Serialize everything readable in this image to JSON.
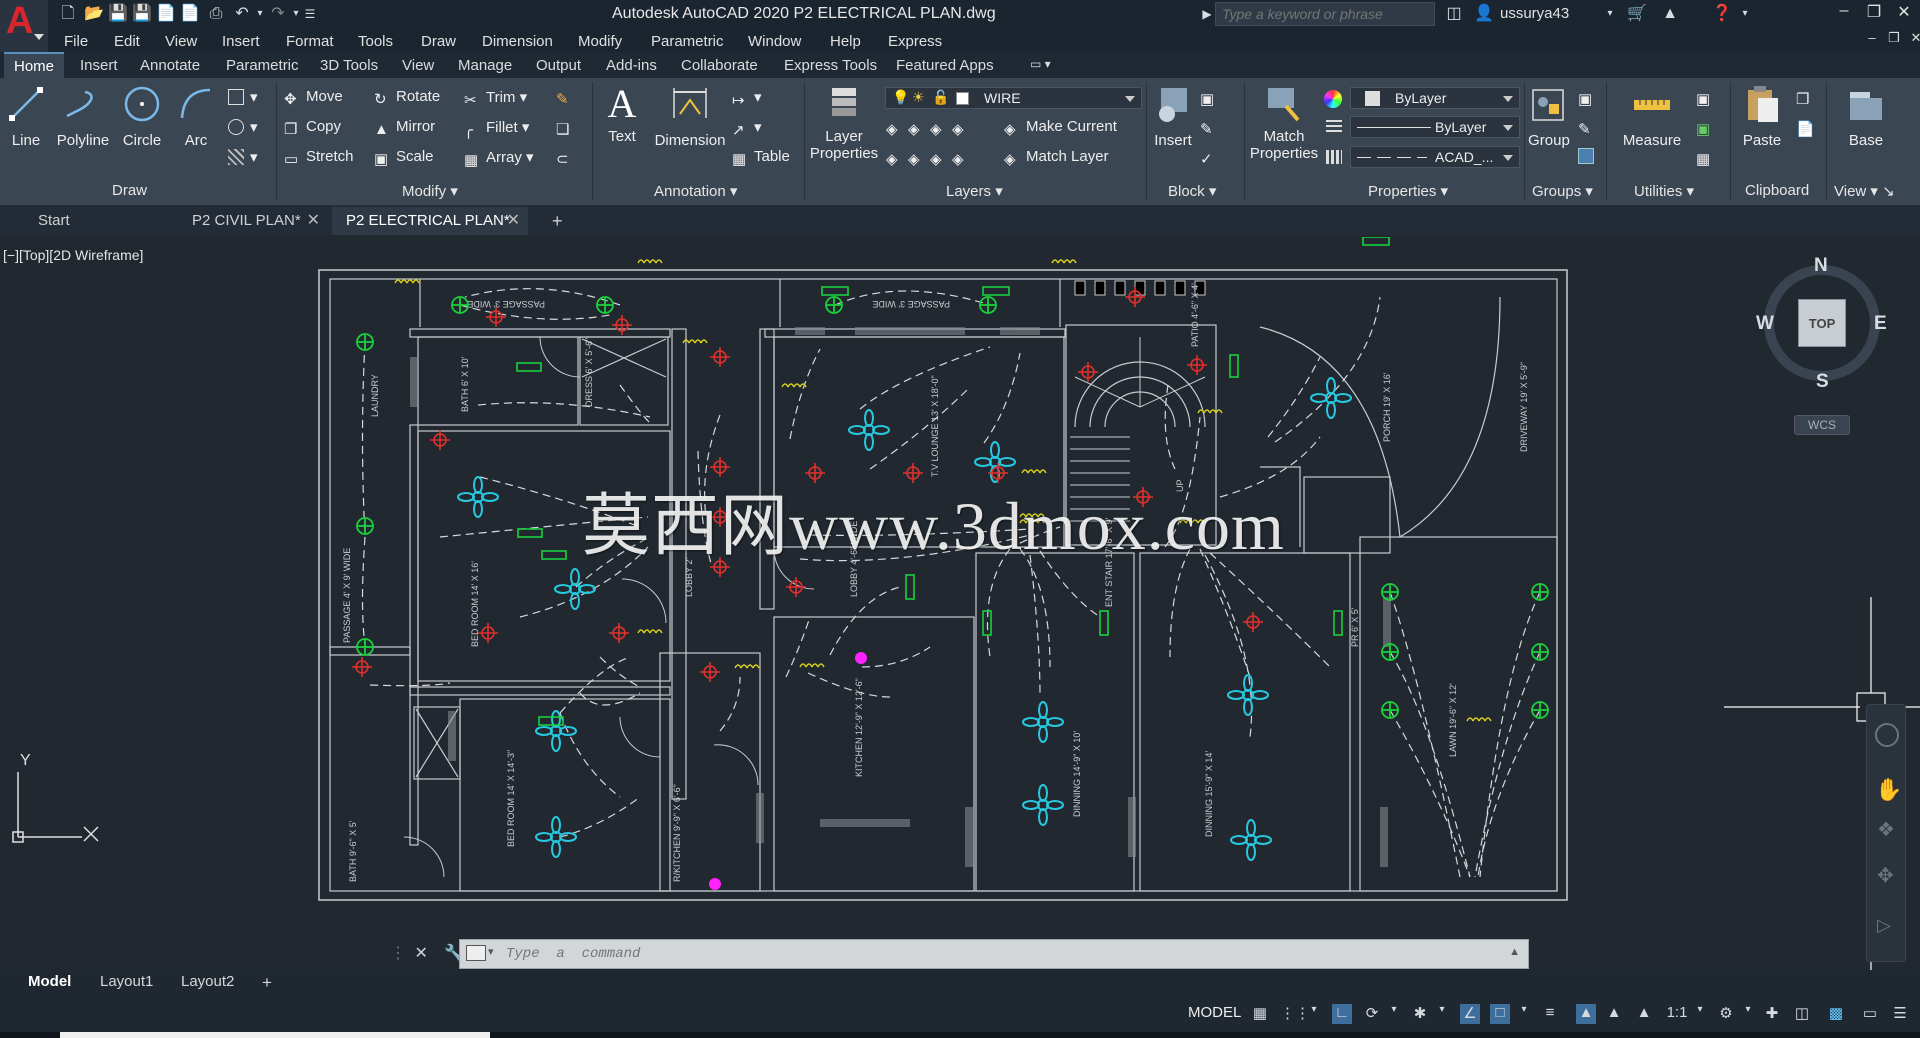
{
  "app": {
    "logo_letter": "A",
    "title": "Autodesk AutoCAD 2020    P2 ELECTRICAL PLAN.dwg",
    "search_placeholder": "Type a keyword or phrase",
    "user": "ussurya43"
  },
  "menu": [
    "File",
    "Edit",
    "View",
    "Insert",
    "Format",
    "Tools",
    "Draw",
    "Dimension",
    "Modify",
    "Parametric",
    "Window",
    "Help",
    "Express"
  ],
  "ribbon_tabs": [
    "Home",
    "Insert",
    "Annotate",
    "Parametric",
    "3D Tools",
    "View",
    "Manage",
    "Output",
    "Add-ins",
    "Collaborate",
    "Express Tools",
    "Featured Apps"
  ],
  "ribbon": {
    "draw": {
      "title": "Draw",
      "line": "Line",
      "polyline": "Polyline",
      "circle": "Circle",
      "arc": "Arc"
    },
    "modify": {
      "title": "Modify",
      "move": "Move",
      "rotate": "Rotate",
      "trim": "Trim",
      "copy": "Copy",
      "mirror": "Mirror",
      "fillet": "Fillet",
      "stretch": "Stretch",
      "scale": "Scale",
      "array": "Array"
    },
    "annotation": {
      "title": "Annotation",
      "text": "Text",
      "dimension": "Dimension",
      "table": "Table"
    },
    "layers": {
      "title": "Layers",
      "layer_properties_1": "Layer",
      "layer_properties_2": "Properties",
      "current_layer": "WIRE",
      "make_current": "Make Current",
      "match_layer": "Match Layer"
    },
    "block": {
      "title": "Block",
      "insert": "Insert"
    },
    "properties": {
      "title": "Properties",
      "match_1": "Match",
      "match_2": "Properties",
      "color": "ByLayer",
      "lineweight": "ByLayer",
      "linetype": "ACAD_..."
    },
    "groups": {
      "title": "Groups",
      "group": "Group"
    },
    "utilities": {
      "title": "Utilities",
      "measure": "Measure"
    },
    "clipboard": {
      "title": "Clipboard",
      "paste": "Paste"
    },
    "view": {
      "title": "View",
      "base": "Base"
    }
  },
  "file_tabs": [
    {
      "label": "Start"
    },
    {
      "label": "P2 CIVIL PLAN*"
    },
    {
      "label": "P2 ELECTRICAL PLAN*"
    }
  ],
  "viewport": {
    "label": "[−][Top][2D Wireframe]",
    "viewcube": {
      "n": "N",
      "s": "S",
      "e": "E",
      "w": "W",
      "face": "TOP",
      "ucs": "WCS"
    },
    "ucs_y": "Y"
  },
  "plan_labels": {
    "passage_top_left": "PASSAGE 3' WIDE",
    "passage_top_right": "PASSAGE 3' WIDE",
    "laundry": "LAUNDRY",
    "bath_top": "BATH 6' X 10'",
    "dress": "DRESS 6' X 5'-6\"",
    "tv_lounge": "T.V LOUNGE 13' X 18'-0\"",
    "porch": "PORCH 19' X 16'",
    "driveway": "DRIVEWAY 19' X 5'-9\"",
    "passage_left": "PASSAGE 4' X 9' WIDE",
    "bed_room_1": "BED ROOM 14' X 16'",
    "lobby_1": "LOBBY 2'",
    "lobby_2": "LOBBY 4'-6\" WIDE",
    "ent_stair": "ENT STAIR 17'-6\" X 9'",
    "patio": "PATIO 4'-6\" X 4'",
    "up": "UP",
    "pr": "PR 6' X 5'",
    "kitchen": "KITCHEN 12'-9\" X 12'-6\"",
    "dining_1": "DINNING 14'-9\" X 10'",
    "dining_2": "DINNING 15'-9\" X 14'",
    "lawn": "LAWN 19'-6\" X 12'",
    "bed_room_2": "BED ROOM 14' X 14'-3\"",
    "rkitchen": "R/KITCHEN 9'-9\" X 6'-6\"",
    "bath_bottom": "BATH 9'-6\" X 5'"
  },
  "watermark": "莫西网www.3dmox.com",
  "command": {
    "placeholder": "Type  a  command"
  },
  "layout_tabs": [
    "Model",
    "Layout1",
    "Layout2"
  ],
  "status": {
    "model": "MODEL",
    "scale": "1:1"
  },
  "colors": {
    "accent": "#5a8fc0",
    "background": "#212830",
    "ribbon": "#3b4653",
    "fan": "#27c9e0",
    "light": "#19d13c",
    "bulb": "#e0302c",
    "switch": "#d8d020",
    "magenta": "#ff21ff"
  }
}
